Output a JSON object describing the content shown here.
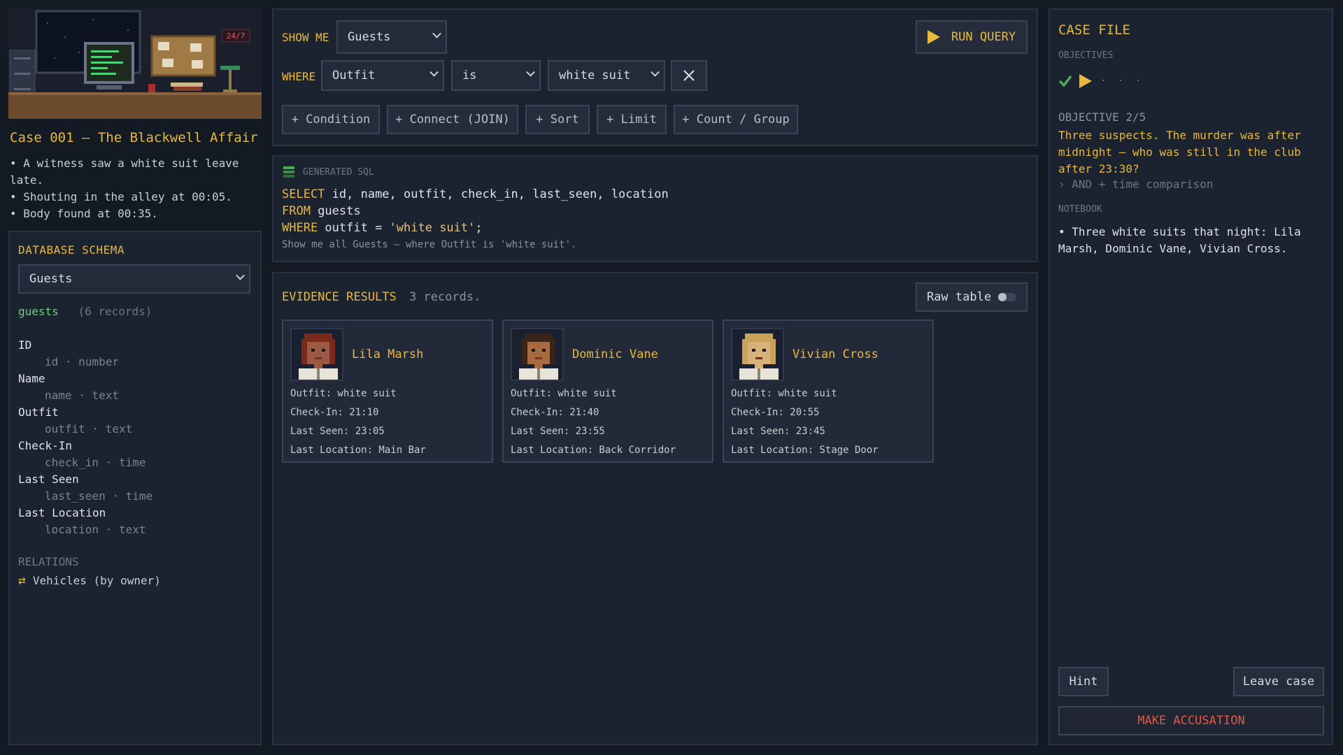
{
  "case": {
    "title": "Case 001 — The Blackwell Affair",
    "clues": [
      "• A witness saw a white suit leave late.",
      "• Shouting in the alley at 00:05.",
      "• Body found at 00:35."
    ],
    "scene_sign": "24/7"
  },
  "schema": {
    "title": "DATABASE SCHEMA",
    "selected_table": "Guests",
    "table_name": "guests",
    "record_count": "(6 records)",
    "fields": [
      {
        "label": "ID",
        "column": "id · number"
      },
      {
        "label": "Name",
        "column": "name · text"
      },
      {
        "label": "Outfit",
        "column": "outfit · text"
      },
      {
        "label": "Check-In",
        "column": "check_in · time"
      },
      {
        "label": "Last Seen",
        "column": "last_seen · time"
      },
      {
        "label": "Last Location",
        "column": "location · text"
      }
    ],
    "relations_title": "RELATIONS",
    "relations": [
      "Vehicles (by owner)"
    ]
  },
  "query": {
    "show_me_label": "SHOW ME",
    "show_me_value": "Guests",
    "run_label": "RUN QUERY",
    "where_label": "WHERE",
    "where_field": "Outfit",
    "where_op": "is",
    "where_value": "white suit",
    "buttons": [
      "+ Condition",
      "+ Connect (JOIN)",
      "+ Sort",
      "+ Limit",
      "+ Count / Group"
    ]
  },
  "sql": {
    "title": "GENERATED SQL",
    "line1_kw": "SELECT",
    "line1_rest": " id, name, outfit, check_in, last_seen, location",
    "line2_kw": "FROM",
    "line2_rest": " guests",
    "line3_kw": "WHERE",
    "line3_rest": " outfit = ",
    "line3_str": "'white suit'",
    "line3_end": ";",
    "plain": "Show me all Guests — where Outfit is 'white suit'."
  },
  "results": {
    "title": "EVIDENCE RESULTS",
    "count": "3 records.",
    "raw_toggle": "Raw table",
    "cards": [
      {
        "name": "Lila Marsh",
        "outfit": "Outfit: white suit",
        "check_in": "Check-In: 21:10",
        "last_seen": "Last Seen: 23:05",
        "location": "Last Location: Main Bar",
        "hair": "#7a2a1c",
        "skin": "#9c5a44"
      },
      {
        "name": "Dominic Vane",
        "outfit": "Outfit: white suit",
        "check_in": "Check-In: 21:40",
        "last_seen": "Last Seen: 23:55",
        "location": "Last Location: Back Corridor",
        "hair": "#3a2418",
        "skin": "#a86a3e"
      },
      {
        "name": "Vivian Cross",
        "outfit": "Outfit: white suit",
        "check_in": "Check-In: 20:55",
        "last_seen": "Last Seen: 23:45",
        "location": "Last Location: Stage Door",
        "hair": "#c9a35a",
        "skin": "#d8b07a"
      }
    ]
  },
  "casefile": {
    "title": "CASE FILE",
    "objectives_label": "OBJECTIVES",
    "progress_dots": "· · ·",
    "objective_number": "OBJECTIVE 2/5",
    "objective_text": "Three suspects. The murder was after midnight — who was still in the club after 23:30?",
    "objective_hint": "› AND + time comparison",
    "notebook_label": "NOTEBOOK",
    "notebook_entry": "• Three white suits that night: Lila Marsh, Dominic Vane, Vivian Cross.",
    "hint_label": "Hint",
    "leave_label": "Leave case",
    "accuse_label": "MAKE ACCUSATION"
  },
  "colors": {
    "accent": "#e8b93c",
    "success": "#4caf50",
    "danger": "#e05a4a",
    "panel": "#1b2230",
    "background": "#141a24"
  }
}
